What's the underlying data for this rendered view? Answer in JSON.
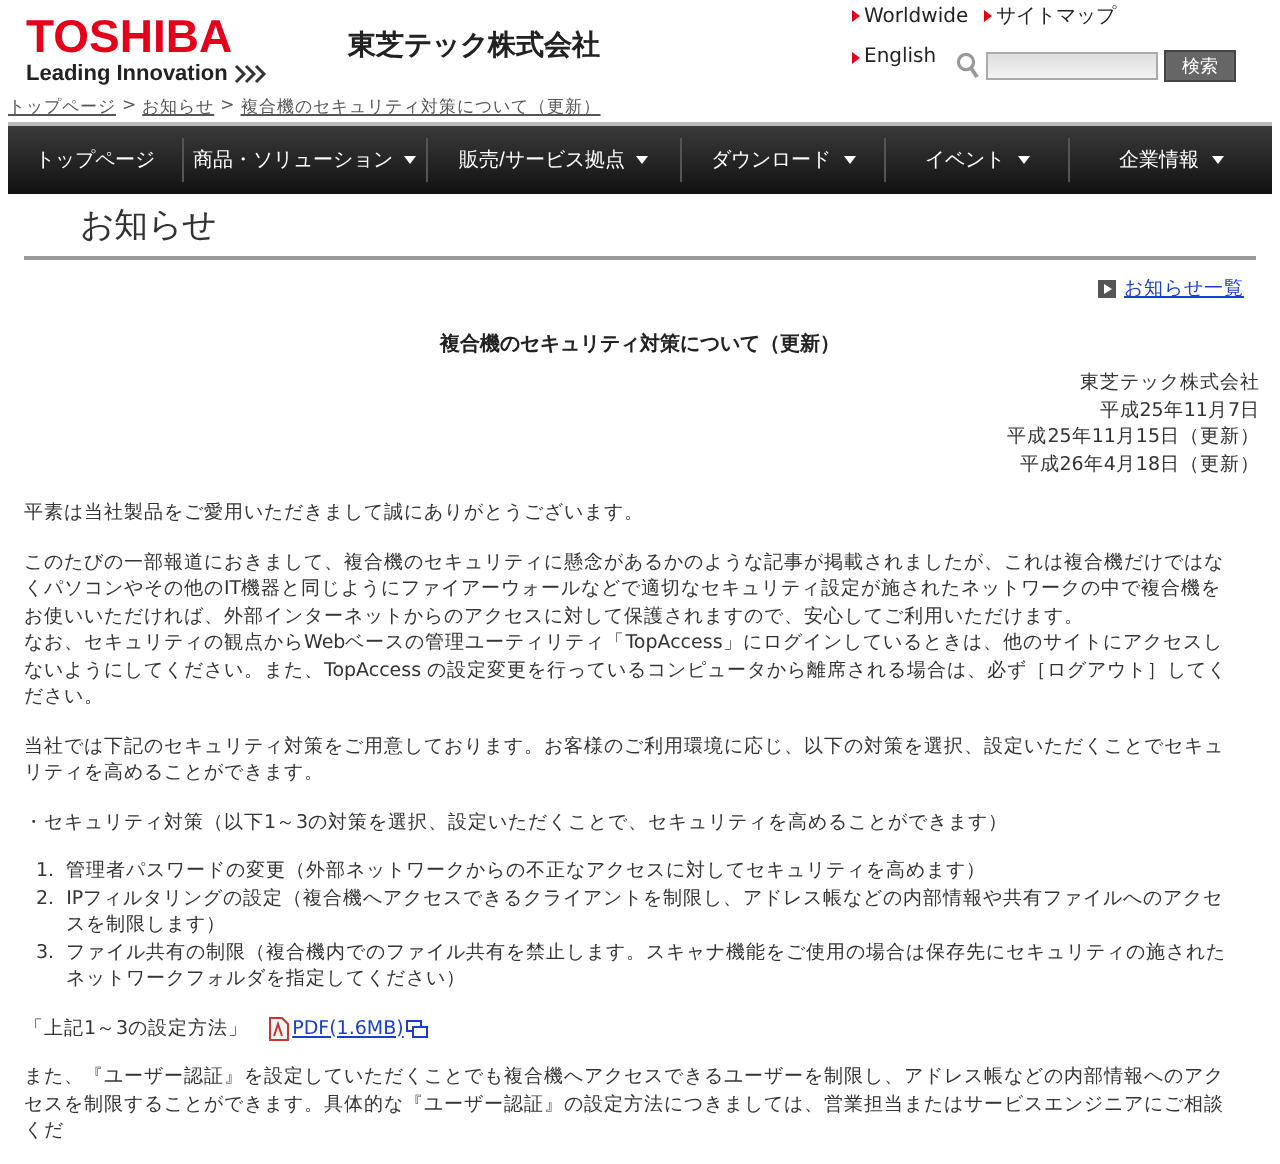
{
  "header": {
    "logo": "TOSHIBA",
    "tagline": "Leading Innovation",
    "company": "東芝テック株式会社",
    "links": [
      "Worldwide",
      "サイトマップ",
      "English"
    ],
    "search_button": "検索"
  },
  "breadcrumb": {
    "separator": ">",
    "items": [
      "トップページ",
      "お知らせ",
      "複合機のセキュリティ対策について（更新）"
    ]
  },
  "nav": [
    {
      "label": "トップページ",
      "dropdown": false
    },
    {
      "label": "商品・ソリューション",
      "dropdown": true
    },
    {
      "label": "販売/サービス拠点",
      "dropdown": true
    },
    {
      "label": "ダウンロード",
      "dropdown": true
    },
    {
      "label": "イベント",
      "dropdown": true
    },
    {
      "label": "企業情報",
      "dropdown": true
    }
  ],
  "page_title": "お知らせ",
  "list_link": "お知らせ一覧",
  "article": {
    "title": "複合機のセキュリティ対策について（更新）",
    "signature": [
      "東芝テック株式会社",
      "平成25年11月7日",
      "平成25年11月15日（更新）",
      "平成26年4月18日（更新）"
    ],
    "blocks": [
      {
        "kind": "para",
        "texts": [
          "平素は当社製品をご愛用いただきまして誠にありがとうございます。"
        ]
      },
      {
        "kind": "para",
        "texts": [
          "このたびの一部報道におきまして、複合機のセキュリティに懸念があるかのような記事が掲載されましたが、これは複合機だけではなくパソコンやその他のIT機器と同じようにファイアーウォールなどで適切なセキュリティ設定が施されたネットワークの中で複合機をお使いいただければ、外部インターネットからのアクセスに対して保護されますので、安心してご利用いただけます。",
          "なお、セキュリティの観点からWebベースの管理ユーティリティ「TopAccess」にログインしているときは、他のサイトにアクセスしないようにしてください。また、TopAccess の設定変更を行っているコンピュータから離席される場合は、必ず［ログアウト］してください。"
        ]
      },
      {
        "kind": "para",
        "texts": [
          "当社では下記のセキュリティ対策をご用意しております。お客様のご利用環境に応じ、以下の対策を選択、設定いただくことでセキュリティを高めることができます。"
        ]
      },
      {
        "kind": "para",
        "texts": [
          "・セキュリティ対策（以下1～3の対策を選択、設定いただくことで、セキュリティを高めることができます）"
        ]
      },
      {
        "kind": "list",
        "items": [
          {
            "number": "1.",
            "text": "管理者パスワードの変更（外部ネットワークからの不正なアクセスに対してセキュリティを高めます）"
          },
          {
            "number": "2.",
            "text": "IPフィルタリングの設定（複合機へアクセスできるクライアントを制限し、アドレス帳などの内部情報や共有ファイルへのアクセスを制限します）"
          },
          {
            "number": "3.",
            "text": "ファイル共有の制限（複合機内でのファイル共有を禁止します。スキャナ機能をご使用の場合は保存先にセキュリティの施されたネットワークフォルダを指定してください）"
          }
        ]
      },
      {
        "kind": "download",
        "label": "「上記1～3の設定方法」",
        "link": "PDF(1.6MB)"
      },
      {
        "kind": "para",
        "texts": [
          "また、『ユーザー認証』を設定していただくことでも複合機へアクセスできるユーザーを制限し、アドレス帳などの内部情報へのアクセスを制限することができます。具体的な『ユーザー認証』の設定方法につきましては、営業担当またはサービスエンジニアにご相談くだ"
        ]
      }
    ]
  }
}
